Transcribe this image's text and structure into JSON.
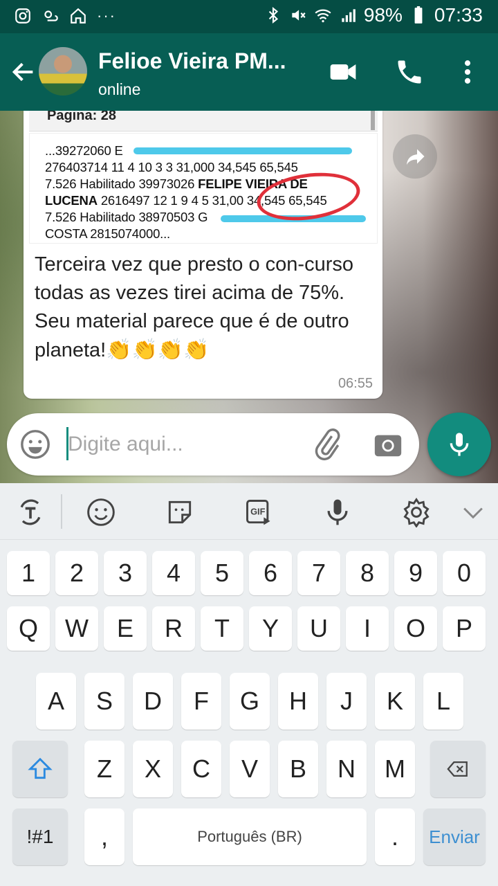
{
  "status_bar": {
    "battery": "98%",
    "time": "07:33"
  },
  "header": {
    "contact_name": "Felioe Vieira PM...",
    "contact_status": "online"
  },
  "message": {
    "image_header": "Pagina: 28",
    "doc_lines": [
      "...39272060 E",
      "276403714 11 4 10 3 3 31,000 34,545 65,545",
      "7.526 Habilitado 39973026 ",
      "LUCENA",
      " 2616497 12 1 9 4 5 31,00",
      " 34,545 65,545",
      "7.526 Habilitado 38970503 G",
      "COSTA 2815074000..."
    ],
    "doc_bold_name": "FELIPE VIEIRA DE",
    "text": "Terceira vez que presto o con-curso todas as vezes tirei acima de 75%. Seu material parece que é de outro planeta!",
    "claps": [
      "👏",
      "👏",
      "👏",
      "👏"
    ],
    "time": "06:55"
  },
  "composer": {
    "placeholder": "Digite aqui..."
  },
  "keyboard": {
    "row1": [
      "1",
      "2",
      "3",
      "4",
      "5",
      "6",
      "7",
      "8",
      "9",
      "0"
    ],
    "row2": [
      "Q",
      "W",
      "E",
      "R",
      "T",
      "Y",
      "U",
      "I",
      "O",
      "P"
    ],
    "row3": [
      "A",
      "S",
      "D",
      "F",
      "G",
      "H",
      "J",
      "K",
      "L"
    ],
    "row4": [
      "Z",
      "X",
      "C",
      "V",
      "B",
      "N",
      "M"
    ],
    "symbols_label": "!#1",
    "comma": ",",
    "space_label": "Português (BR)",
    "period": ".",
    "send_label": "Enviar"
  },
  "colors": {
    "header": "#075e54",
    "statusbar": "#054d44",
    "accent": "#128c7e",
    "send": "#3d8fd1"
  }
}
